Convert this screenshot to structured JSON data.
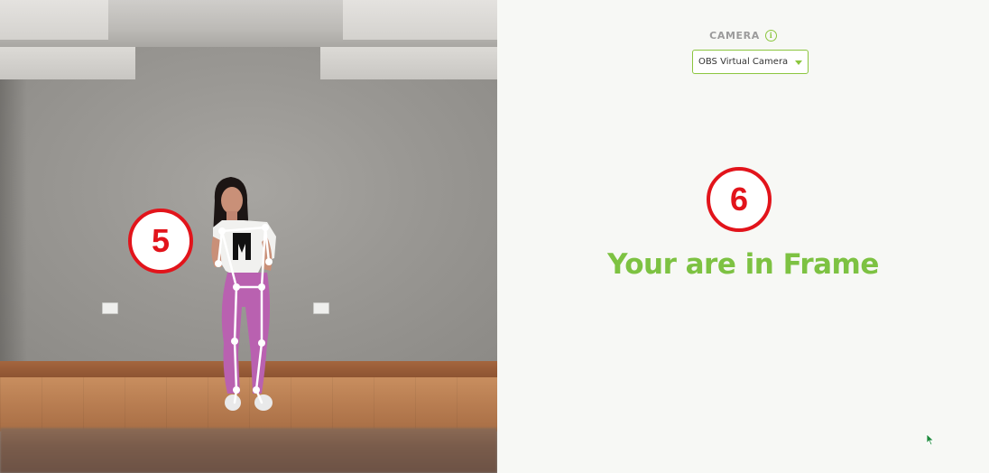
{
  "feed": {
    "skeleton_color": "#ffffff",
    "wall_color": "#9a9894",
    "floor_color": "#b87d51"
  },
  "badges": {
    "left": "5",
    "right": "6",
    "color": "#e2141b"
  },
  "panel": {
    "camera_label": "CAMERA",
    "info_icon": "info-icon",
    "camera_select": {
      "selected": "OBS Virtual Camera",
      "caret_icon": "caret-down-icon"
    },
    "status_message": "Your are in Frame",
    "accent_color": "#7dc242"
  },
  "cursor": {
    "icon": "mouse-pointer-icon"
  }
}
